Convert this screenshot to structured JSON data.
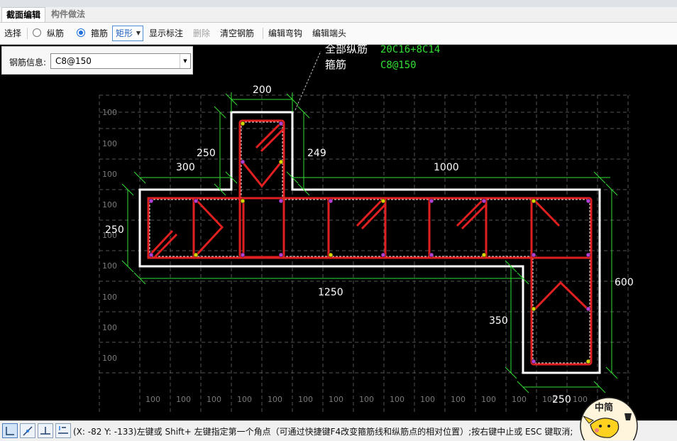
{
  "tabs": [
    {
      "label": "截面编辑",
      "active": true
    },
    {
      "label": "构件做法",
      "active": false
    }
  ],
  "toolbar": {
    "select": "选择",
    "longitudinal": "纵筋",
    "stirrup": "箍筋",
    "shape": "矩形",
    "show_dims": "显示标注",
    "delete": "删除",
    "clear": "清空钢筋",
    "edit_hook": "编辑弯钩",
    "edit_end": "编辑端头"
  },
  "rebar_info": {
    "label": "钢筋信息:",
    "value": "C8@150"
  },
  "canvas": {
    "legend_all_long_label": "全部纵筋",
    "legend_all_long_value": "20C16+8C14",
    "legend_stirrup_label": "箍筋",
    "legend_stirrup_value": "C8@150",
    "dims": {
      "top_width": "200",
      "left_depth": "250",
      "right_depth": "249",
      "left_width": "300",
      "right_width": "1000",
      "flange_height": "250",
      "total_width": "1250",
      "leg_height": "350",
      "total_height": "600",
      "leg_width": "250"
    },
    "grid_label": "100",
    "colors": {
      "background": "#000000",
      "outline": "#ffffff",
      "stirrup": "#e02020",
      "dimension": "#33e033",
      "dim_text": "#ffffff",
      "legend_value": "#33e033",
      "grid": "#555555"
    }
  },
  "status": {
    "text": "(X: -82 Y: -133)左键或 Shift+ 左键指定第一个角点（可通过快捷键F4改变箍筋线和纵筋点的相对位置）;按右键中止或 ESC 键取消;"
  },
  "mascot": {
    "badge": "中简"
  }
}
